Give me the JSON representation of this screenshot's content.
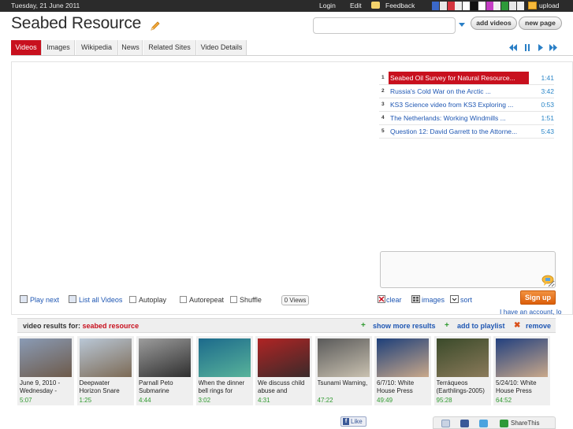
{
  "topbar": {
    "date": "Tuesday, 21 June 2011",
    "login": "Login",
    "edit": "Edit",
    "feedback": "Feedback",
    "upload": "upload",
    "swatch_colors": [
      "#3b68c8",
      "#e8e8e8",
      "#d4343f",
      "#eeeeee",
      "#ffffff",
      "#111111",
      "#ffffff",
      "#c43ec4",
      "#eeeeee",
      "#2f9a3a",
      "#e8e8e8",
      "#f0f0f0"
    ]
  },
  "header": {
    "title": "Seabed Resource",
    "search_value": "",
    "add_videos": "add videos",
    "new_page": "new page"
  },
  "tabs": [
    "Videos",
    "Images",
    "Wikipedia",
    "News",
    "Related Sites",
    "Video Details"
  ],
  "playlist": [
    {
      "num": "1",
      "title": "Seabed Oil Survey for Natural Resource...",
      "time": "1:41",
      "active": true
    },
    {
      "num": "2",
      "title": "Russia's Cold War on the Arctic        ...",
      "time": "3:42",
      "active": false
    },
    {
      "num": "3",
      "title": "KS3 Science video from KS3 Exploring ...",
      "time": "0:53",
      "active": false
    },
    {
      "num": "4",
      "title": "The Netherlands: Working Windmills    ...",
      "time": "1:51",
      "active": false
    },
    {
      "num": "5",
      "title": "Question 12: David Garrett to the Attorne...",
      "time": "5:43",
      "active": false
    }
  ],
  "options": {
    "play_next": "Play next",
    "list_all": "List all Videos",
    "autoplay": "Autoplay",
    "autorepeat": "Autorepeat",
    "shuffle": "Shuffle",
    "views": "0 Views",
    "clear": "clear",
    "images": "images",
    "sort": "sort",
    "sign_up": "Sign up",
    "account": "I have an account, lo"
  },
  "results": {
    "label": "video results for:",
    "query": "seabed resource",
    "show_more": "show more results",
    "add_playlist": "add to playlist",
    "remove": "remove"
  },
  "thumbnails": [
    {
      "caption": "June 9, 2010 - Wednesday -",
      "duration": "5:07",
      "colors": [
        "#8a9bb5",
        "#6d5a4a"
      ]
    },
    {
      "caption": "Deepwater Horizon Snare",
      "duration": "1:25",
      "colors": [
        "#b9c7d6",
        "#7c6a55"
      ]
    },
    {
      "caption": "Parnall Peto Submarine",
      "duration": "4:44",
      "colors": [
        "#9c9c9c",
        "#2f2f2f"
      ]
    },
    {
      "caption": "When the dinner bell rings for",
      "duration": "3:02",
      "colors": [
        "#1c6a8c",
        "#58b39a"
      ]
    },
    {
      "caption": "We discuss child abuse and",
      "duration": "4:31",
      "colors": [
        "#b02424",
        "#3a2a2a"
      ]
    },
    {
      "caption": "Tsunami Warning,",
      "duration": "47:22",
      "colors": [
        "#5a5a5a",
        "#c9c1b0"
      ]
    },
    {
      "caption": "6/7/10: White House Press",
      "duration": "49:49",
      "colors": [
        "#1d3f7a",
        "#c9a88a"
      ]
    },
    {
      "caption": "Terráqueos (Earthlings-2005)",
      "duration": "95:28",
      "colors": [
        "#3a4a2a",
        "#8a7a5a"
      ]
    },
    {
      "caption": "5/24/10: White House Press",
      "duration": "64:52",
      "colors": [
        "#22407f",
        "#c9a88a"
      ]
    }
  ],
  "footer": {
    "like": "Like",
    "share": "ShareThis"
  }
}
